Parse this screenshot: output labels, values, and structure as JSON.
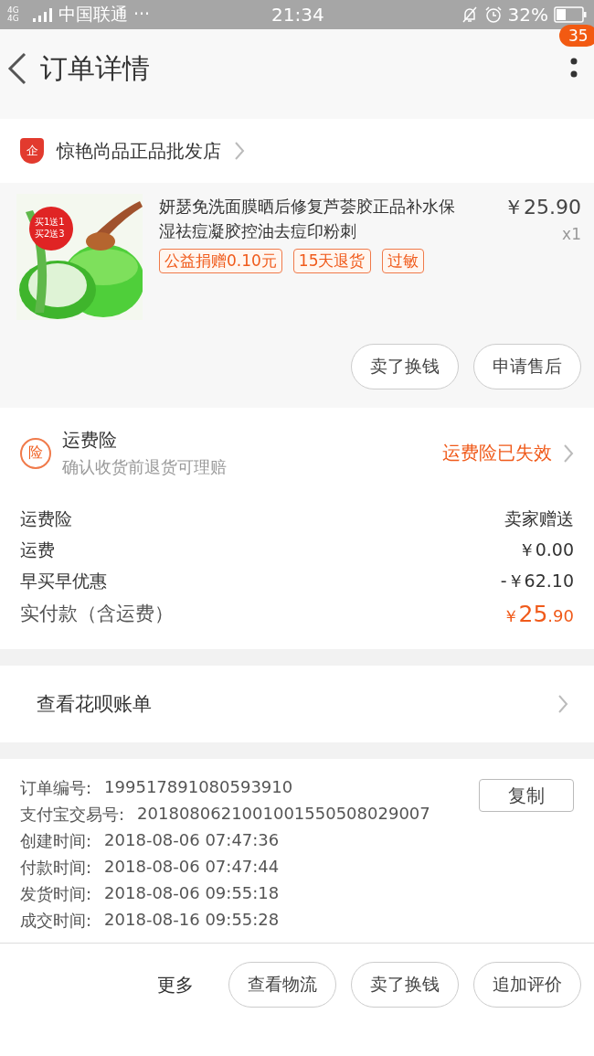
{
  "status_bar": {
    "network": "4G 4G",
    "carrier": "中国联通 ···",
    "time": "21:34",
    "battery": "32%"
  },
  "header": {
    "title": "订单详情",
    "badge": "35"
  },
  "shop": {
    "icon_text": "企",
    "name": "惊艳尚品正品批发店"
  },
  "product": {
    "promo_lines": [
      "买1送1",
      "买2送3"
    ],
    "title": "妍瑟免洗面膜晒后修复芦荟胶正品补水保湿祛痘凝胶控油去痘印粉刺",
    "price": "￥25.90",
    "quantity": "x1",
    "tags": [
      "公益捐赠0.10元",
      "15天退货",
      "过敏"
    ],
    "actions": [
      "卖了换钱",
      "申请售后"
    ]
  },
  "insurance": {
    "icon_text": "险",
    "title": "运费险",
    "subtitle": "确认收货前退货可理赔",
    "status": "运费险已失效"
  },
  "fees": [
    {
      "label": "运费险",
      "value": "卖家赠送"
    },
    {
      "label": "运费",
      "value": "￥0.00"
    },
    {
      "label": "早买早优惠",
      "value": "-￥62.10"
    }
  ],
  "total": {
    "label": "实付款（含运费）",
    "currency": "￥",
    "integer": "25",
    "decimal": ".90"
  },
  "huabei": {
    "label": "查看花呗账单"
  },
  "order_info": [
    {
      "label": "订单编号:",
      "value": "199517891080593910"
    },
    {
      "label": "支付宝交易号:",
      "value": "2018080621001001550508029007"
    },
    {
      "label": "创建时间:",
      "value": "2018-08-06 07:47:36"
    },
    {
      "label": "付款时间:",
      "value": "2018-08-06 07:47:44"
    },
    {
      "label": "发货时间:",
      "value": "2018-08-06 09:55:18"
    },
    {
      "label": "成交时间:",
      "value": "2018-08-16 09:55:28"
    }
  ],
  "copy_button": "复制",
  "bottom_bar": {
    "more": "更多",
    "buttons": [
      "查看物流",
      "卖了换钱",
      "追加评价"
    ]
  }
}
